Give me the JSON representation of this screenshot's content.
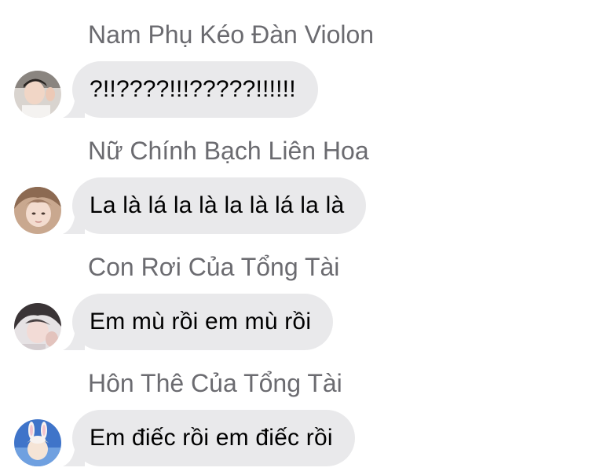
{
  "messages": [
    {
      "sender": "Nam Phụ Kéo Đàn Violon",
      "text": "?!!????!!!?????!!!!!!",
      "avatar_icon": "user-photo-icon"
    },
    {
      "sender": "Nữ Chính Bạch Liên Hoa",
      "text": "La là lá la là la là lá la là",
      "avatar_icon": "user-photo-icon"
    },
    {
      "sender": "Con Rơi Của Tổng Tài",
      "text": "Em mù rồi em mù rồi",
      "avatar_icon": "user-photo-icon"
    },
    {
      "sender": "Hôn Thê Của Tổng Tài",
      "text": "Em điếc rồi em điếc rồi",
      "avatar_icon": "user-photo-icon"
    }
  ],
  "colors": {
    "bubble": "#e9e9eb",
    "sender_text": "#6b6b70",
    "message_text": "#000000",
    "background": "#ffffff"
  }
}
